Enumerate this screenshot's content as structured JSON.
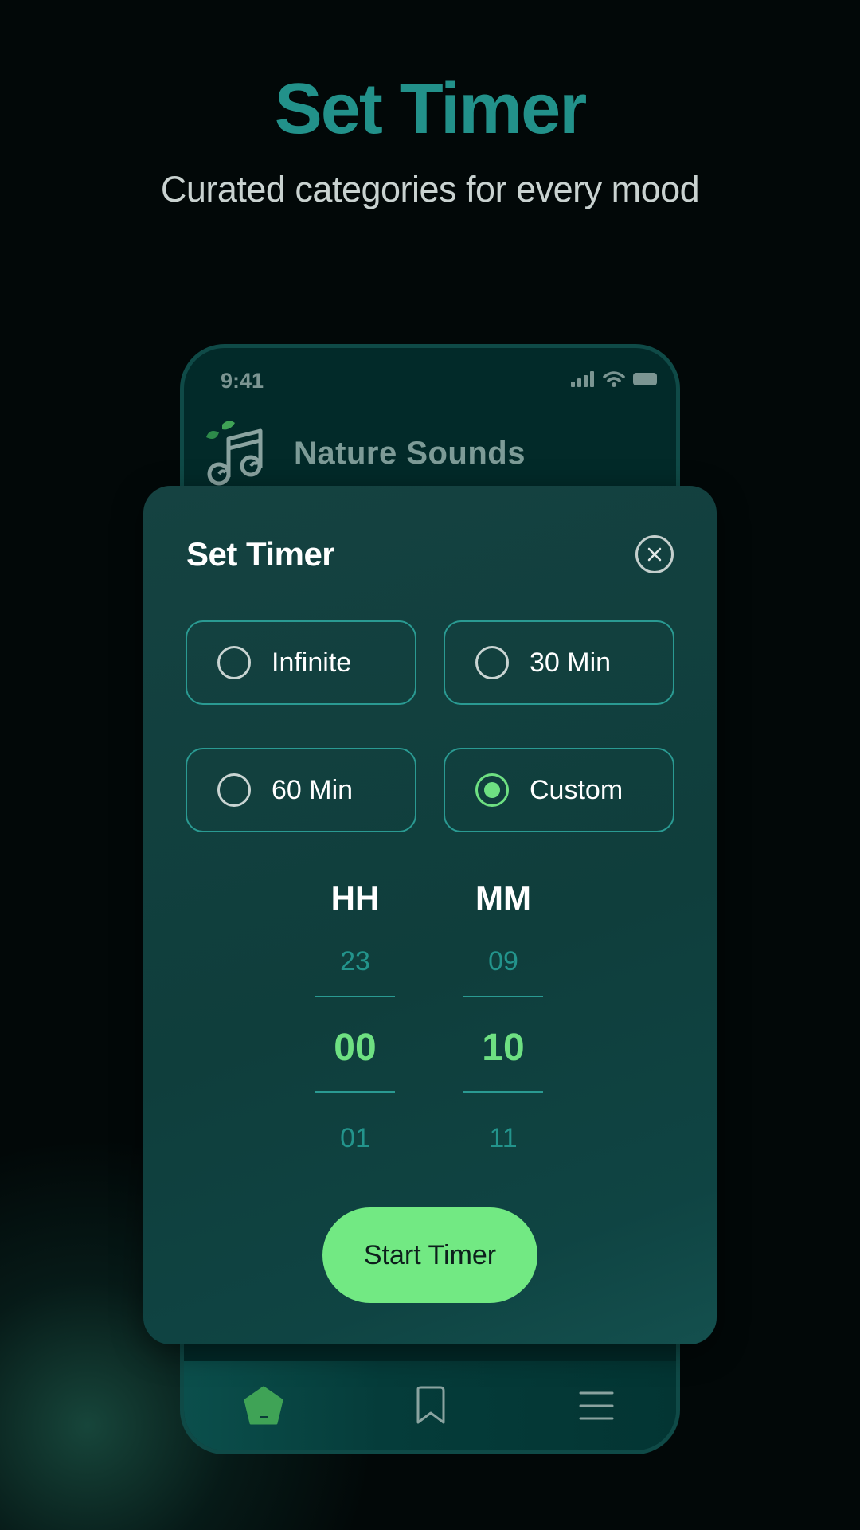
{
  "header": {
    "title": "Set Timer",
    "subtitle": "Curated categories for every mood"
  },
  "phone": {
    "status_time": "9:41",
    "app_title": "Nature Sounds",
    "icons": {
      "signal": "signal-icon",
      "wifi": "wifi-icon",
      "battery": "battery-icon",
      "logo": "music-note-leaf-logo",
      "nav_home": "home-icon",
      "nav_bookmark": "bookmark-icon",
      "nav_menu": "menu-icon"
    }
  },
  "modal": {
    "title": "Set Timer",
    "close_icon": "close-icon",
    "options": [
      {
        "label": "Infinite",
        "selected": false
      },
      {
        "label": "30 Min",
        "selected": false
      },
      {
        "label": "60 Min",
        "selected": false
      },
      {
        "label": "Custom",
        "selected": true
      }
    ],
    "picker": {
      "hours": {
        "header": "HH",
        "prev": "23",
        "current": "00",
        "next": "01"
      },
      "minutes": {
        "header": "MM",
        "prev": "09",
        "current": "10",
        "next": "11"
      }
    },
    "start_label": "Start Timer"
  },
  "colors": {
    "accent": "#22918a",
    "highlight": "#6ee082",
    "button": "#72e983",
    "modal_bg": "#0f3e3c"
  }
}
